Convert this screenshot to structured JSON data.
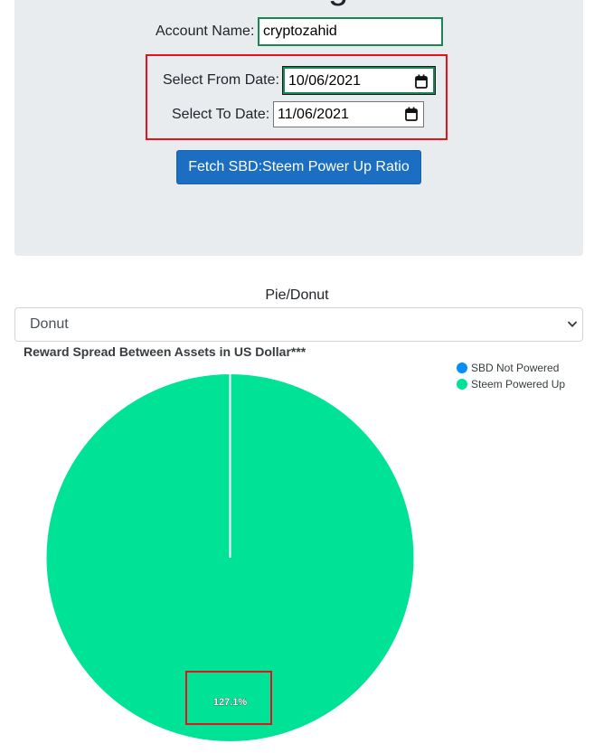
{
  "header": {
    "title": "earnings"
  },
  "form": {
    "account_label": "Account Name:",
    "account_value": "cryptozahid",
    "from_label": "Select From Date:",
    "from_value": "10/06/2021",
    "to_label": "Select To Date:",
    "to_value": "11/06/2021",
    "fetch_button": "Fetch SBD:Steem Power Up Ratio"
  },
  "chart_type_select": {
    "label": "Pie/Donut",
    "selected": "Donut"
  },
  "colors": {
    "primary_button": "#1b6ec2",
    "highlight": "#e8101a",
    "sbd": "#008ffb",
    "steem": "#00e396"
  },
  "chart_data": {
    "type": "pie",
    "title": "Reward Spread Between Assets in US Dollar***",
    "legend_position": "top-right",
    "slices": [
      {
        "label": "SBD Not Powered",
        "value": 0,
        "color": "#008ffb"
      },
      {
        "label": "Steem Powered Up",
        "value": 100,
        "color": "#00e396"
      }
    ],
    "data_labels": [
      "127.1%"
    ]
  }
}
